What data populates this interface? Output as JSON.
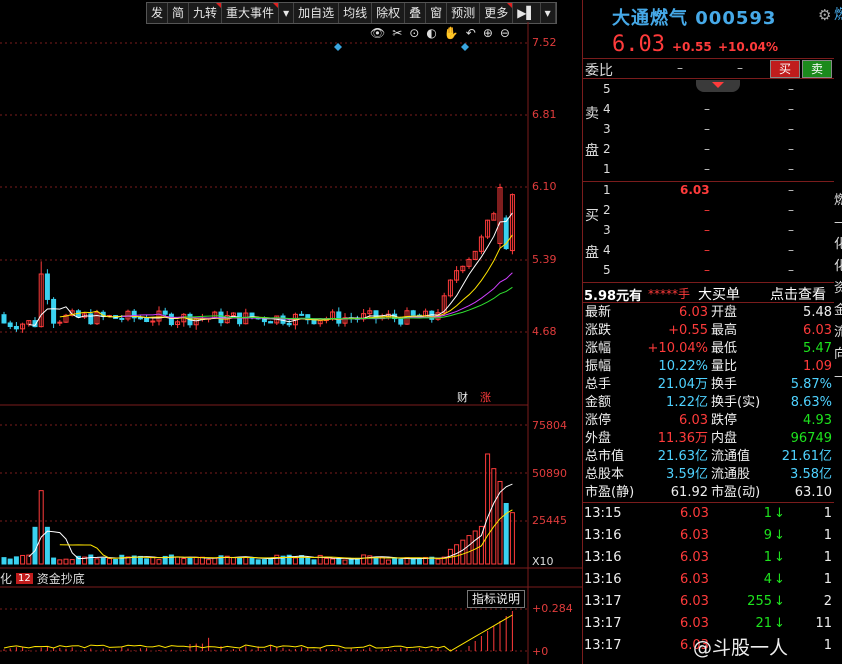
{
  "toolbar": [
    "发",
    "简",
    "九转",
    "重大事件",
    "▾",
    "加自选",
    "均线",
    "除权",
    "叠",
    "窗",
    "预测",
    "更多",
    "▶▌",
    "▾"
  ],
  "tools": [
    "👁",
    "✂",
    "⊙",
    "◐",
    "✋",
    "↶",
    "⊕",
    "⊖"
  ],
  "axis": {
    "price": [
      "7.52",
      "6.81",
      "6.10",
      "5.39",
      "4.68"
    ],
    "volume": [
      "75804",
      "50890",
      "25445",
      "X10"
    ],
    "indicator": [
      "+0.284",
      "+0"
    ]
  },
  "markers": {
    "cai": "财",
    "zhang": "涨"
  },
  "stock": {
    "name": "大通燃气",
    "code": "000593",
    "price": "6.03",
    "change": "+0.55",
    "pct": "+10.04%",
    "side_char": "燃"
  },
  "orderbook": {
    "weibi": "委比",
    "weibi_a": "–",
    "weibi_b": "–",
    "buy_btn": "买",
    "sell_btn": "卖",
    "sell_label": [
      "卖",
      "盘"
    ],
    "buy_label": [
      "买",
      "盘"
    ],
    "sells": [
      {
        "n": "5",
        "p": "",
        "v": "–"
      },
      {
        "n": "4",
        "p": "–",
        "v": "–"
      },
      {
        "n": "3",
        "p": "–",
        "v": "–"
      },
      {
        "n": "2",
        "p": "–",
        "v": "–"
      },
      {
        "n": "1",
        "p": "–",
        "v": "–"
      }
    ],
    "buys": [
      {
        "n": "1",
        "p": "6.03",
        "v": "–"
      },
      {
        "n": "2",
        "p": "–",
        "v": "–"
      },
      {
        "n": "3",
        "p": "–",
        "v": "–"
      },
      {
        "n": "4",
        "p": "–",
        "v": "–"
      },
      {
        "n": "5",
        "p": "–",
        "v": "–"
      }
    ]
  },
  "bigorder": {
    "price": "5.98元有",
    "stars": "*****手",
    "label": "大买单",
    "check": "点击查看"
  },
  "info": [
    {
      "l1": "最新",
      "v1": "6.03",
      "c1": "red",
      "l2": "开盘",
      "v2": "5.48",
      "c2": "white"
    },
    {
      "l1": "涨跌",
      "v1": "+0.55",
      "c1": "red",
      "l2": "最高",
      "v2": "6.03",
      "c2": "red"
    },
    {
      "l1": "涨幅",
      "v1": "+10.04%",
      "c1": "red",
      "l2": "最低",
      "v2": "5.47",
      "c2": "green"
    },
    {
      "l1": "振幅",
      "v1": "10.22%",
      "c1": "cyan",
      "l2": "量比",
      "v2": "1.09",
      "c2": "red"
    },
    {
      "l1": "总手",
      "v1": "21.04万",
      "c1": "cyan",
      "l2": "换手",
      "v2": "5.87%",
      "c2": "cyan"
    },
    {
      "l1": "金额",
      "v1": "1.22亿",
      "c1": "cyan",
      "l2": "换手(实)",
      "v2": "8.63%",
      "c2": "cyan"
    },
    {
      "l1": "涨停",
      "v1": "6.03",
      "c1": "red",
      "l2": "跌停",
      "v2": "4.93",
      "c2": "green"
    },
    {
      "l1": "外盘",
      "v1": "11.36万",
      "c1": "red",
      "l2": "内盘",
      "v2": "96749",
      "c2": "green"
    },
    {
      "l1": "总市值",
      "v1": "21.63亿",
      "c1": "cyan",
      "l2": "流通值",
      "v2": "21.61亿",
      "c2": "cyan"
    },
    {
      "l1": "总股本",
      "v1": "3.59亿",
      "c1": "cyan",
      "l2": "流通股",
      "v2": "3.58亿",
      "c2": "cyan"
    },
    {
      "l1": "市盈(静)",
      "v1": "61.92",
      "c1": "white",
      "l2": "市盈(动)",
      "v2": "63.10",
      "c2": "white"
    }
  ],
  "ticks": [
    {
      "t": "13:15",
      "p": "6.03",
      "v": "1",
      "d": "↓",
      "e": "1"
    },
    {
      "t": "13:16",
      "p": "6.03",
      "v": "9",
      "d": "↓",
      "e": "1"
    },
    {
      "t": "13:16",
      "p": "6.03",
      "v": "1",
      "d": "↓",
      "e": "1"
    },
    {
      "t": "13:16",
      "p": "6.03",
      "v": "4",
      "d": "↓",
      "e": "1"
    },
    {
      "t": "13:17",
      "p": "6.03",
      "v": "255",
      "d": "↓",
      "e": "2"
    },
    {
      "t": "13:17",
      "p": "6.03",
      "v": "21",
      "d": "↓",
      "e": "11"
    },
    {
      "t": "13:17",
      "p": "6.03",
      "v": "",
      "d": "",
      "e": "1"
    }
  ],
  "right_edge": [
    "燃",
    "—",
    "化",
    "化",
    "资",
    "金",
    "流",
    "向",
    "—"
  ],
  "bottom_tabs": {
    "left": "化",
    "num": "12",
    "name": "资金抄底"
  },
  "indicator_btn": "指标说明",
  "watermark": "@斗股一人",
  "colors": {
    "up": "#ff3b3b",
    "down": "#1ee31e",
    "accent": "#46a9e8",
    "panel_border": "#7a1c1c"
  }
}
